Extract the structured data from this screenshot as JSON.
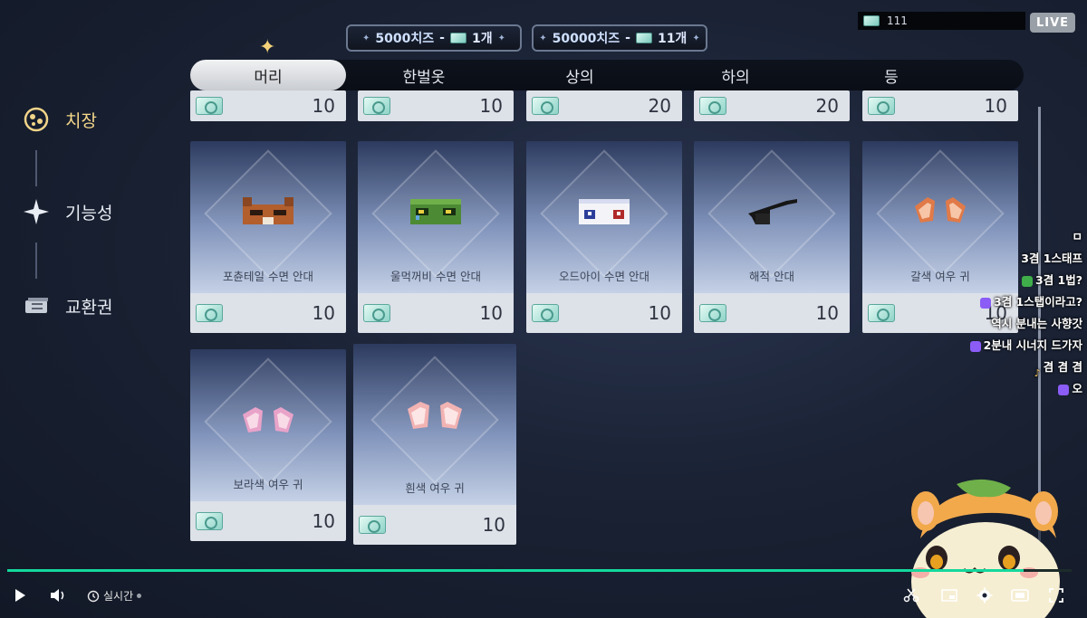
{
  "packs": [
    {
      "amount": "5000치즈",
      "dash": "-",
      "count": "1개"
    },
    {
      "amount": "50000치즈",
      "dash": "-",
      "count": "11개"
    }
  ],
  "live": {
    "ticket_count": "111",
    "badge": "LIVE"
  },
  "tabs": [
    "머리",
    "한벌옷",
    "상의",
    "하의",
    "등"
  ],
  "active_tab": "머리",
  "sidebar": {
    "items": [
      {
        "label": "치장",
        "icon": "cosmetic-icon",
        "active": true
      },
      {
        "label": "기능성",
        "icon": "sparkle-icon",
        "active": false
      },
      {
        "label": "교환권",
        "icon": "ticket-icon",
        "active": false
      }
    ]
  },
  "partial_row": {
    "prices": [
      "10",
      "10",
      "20",
      "20",
      "10"
    ]
  },
  "cards": [
    {
      "name": "포츈테일 수면 안대",
      "price": "10",
      "item": "fox-mask"
    },
    {
      "name": "울먹꺼비 수면 안대",
      "price": "10",
      "item": "frog-mask"
    },
    {
      "name": "오드아이 수면 안대",
      "price": "10",
      "item": "oddeye-mask"
    },
    {
      "name": "해적 안대",
      "price": "10",
      "item": "pirate-patch"
    },
    {
      "name": "갈색 여우 귀",
      "price": "10",
      "item": "brown-fox-ears"
    },
    {
      "name": "보라색 여우 귀",
      "price": "10",
      "item": "purple-fox-ears"
    },
    {
      "name": "흰색 여우 귀",
      "price": "10",
      "item": "white-fox-ears"
    }
  ],
  "chat": [
    {
      "text": "ㅁ",
      "icon": ""
    },
    {
      "text": "3겸 1스태프",
      "icon": ""
    },
    {
      "text": "3겸 1법?",
      "icon": "clover"
    },
    {
      "text": "3겸 1스탭이라고?",
      "icon": "heart"
    },
    {
      "text": "역시 분내는 사향갓",
      "icon": ""
    },
    {
      "text": "2분내 시너지 드가자",
      "icon": "heart"
    },
    {
      "text": "겸 겸 겸",
      "icon": "note"
    },
    {
      "text": "오",
      "icon": "heart"
    }
  ],
  "player": {
    "realtime_label": "실시간",
    "progress": 0.955
  },
  "colors": {
    "accent_gold": "#f6d98a",
    "progress_green": "#13d89c",
    "live_gray": "#9aa0a8"
  }
}
